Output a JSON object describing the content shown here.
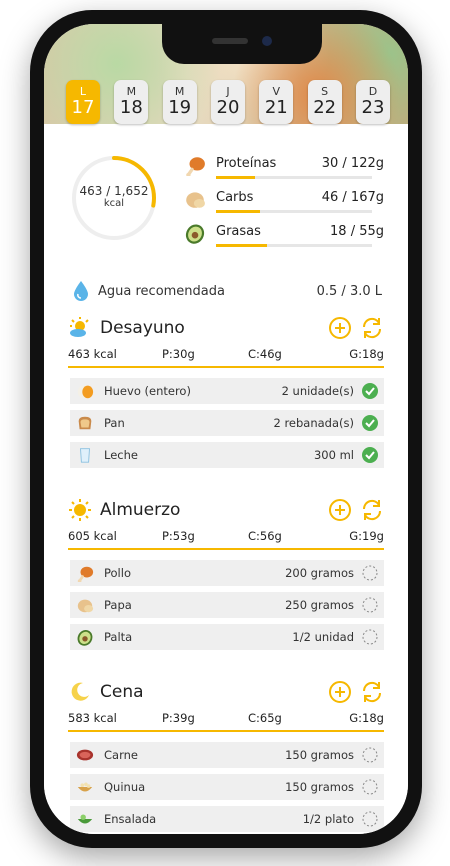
{
  "days": [
    {
      "letter": "L",
      "num": "17",
      "active": true
    },
    {
      "letter": "M",
      "num": "18",
      "active": false
    },
    {
      "letter": "M",
      "num": "19",
      "active": false
    },
    {
      "letter": "J",
      "num": "20",
      "active": false
    },
    {
      "letter": "V",
      "num": "21",
      "active": false
    },
    {
      "letter": "S",
      "num": "22",
      "active": false
    },
    {
      "letter": "D",
      "num": "23",
      "active": false
    }
  ],
  "summary": {
    "kcal_value": "463 / 1,652",
    "kcal_unit": "kcal",
    "kcal_progress": 0.28
  },
  "macros": [
    {
      "name": "Proteínas",
      "value": "30 / 122g",
      "progress": 0.25,
      "icon": "drumstick-icon"
    },
    {
      "name": "Carbs",
      "value": "46 / 167g",
      "progress": 0.28,
      "icon": "potato-icon"
    },
    {
      "name": "Grasas",
      "value": "18 / 55g",
      "progress": 0.33,
      "icon": "avocado-icon"
    }
  ],
  "water": {
    "label": "Agua recomendada",
    "value": "0.5 / 3.0 L",
    "icon": "water-drop-icon"
  },
  "meals": [
    {
      "title": "Desayuno",
      "icon": "sun-cloud-icon",
      "kcal": "463 kcal",
      "p": "P:30g",
      "c": "C:46g",
      "g": "G:18g",
      "items": [
        {
          "name": "Huevo (entero)",
          "qty": "2 unidade(s)",
          "done": true,
          "icon": "egg-icon"
        },
        {
          "name": "Pan",
          "qty": "2 rebanada(s)",
          "done": true,
          "icon": "bread-icon"
        },
        {
          "name": "Leche",
          "qty": "300 ml",
          "done": true,
          "icon": "milk-glass-icon"
        }
      ]
    },
    {
      "title": "Almuerzo",
      "icon": "sun-icon",
      "kcal": "605 kcal",
      "p": "P:53g",
      "c": "C:56g",
      "g": "G:19g",
      "items": [
        {
          "name": "Pollo",
          "qty": "200 gramos",
          "done": false,
          "icon": "drumstick-icon"
        },
        {
          "name": "Papa",
          "qty": "250 gramos",
          "done": false,
          "icon": "potato-icon"
        },
        {
          "name": "Palta",
          "qty": "1/2 unidad",
          "done": false,
          "icon": "avocado-icon"
        }
      ]
    },
    {
      "title": "Cena",
      "icon": "moon-icon",
      "kcal": "583 kcal",
      "p": "P:39g",
      "c": "C:65g",
      "g": "G:18g",
      "items": [
        {
          "name": "Carne",
          "qty": "150 gramos",
          "done": false,
          "icon": "meat-icon"
        },
        {
          "name": "Quinua",
          "qty": "150 gramos",
          "done": false,
          "icon": "quinoa-icon"
        },
        {
          "name": "Ensalada",
          "qty": "1/2 plato",
          "done": false,
          "icon": "salad-icon"
        }
      ]
    }
  ],
  "colors": {
    "accent": "#f6b800",
    "check": "#4caf50",
    "item_bg": "#efefef"
  }
}
